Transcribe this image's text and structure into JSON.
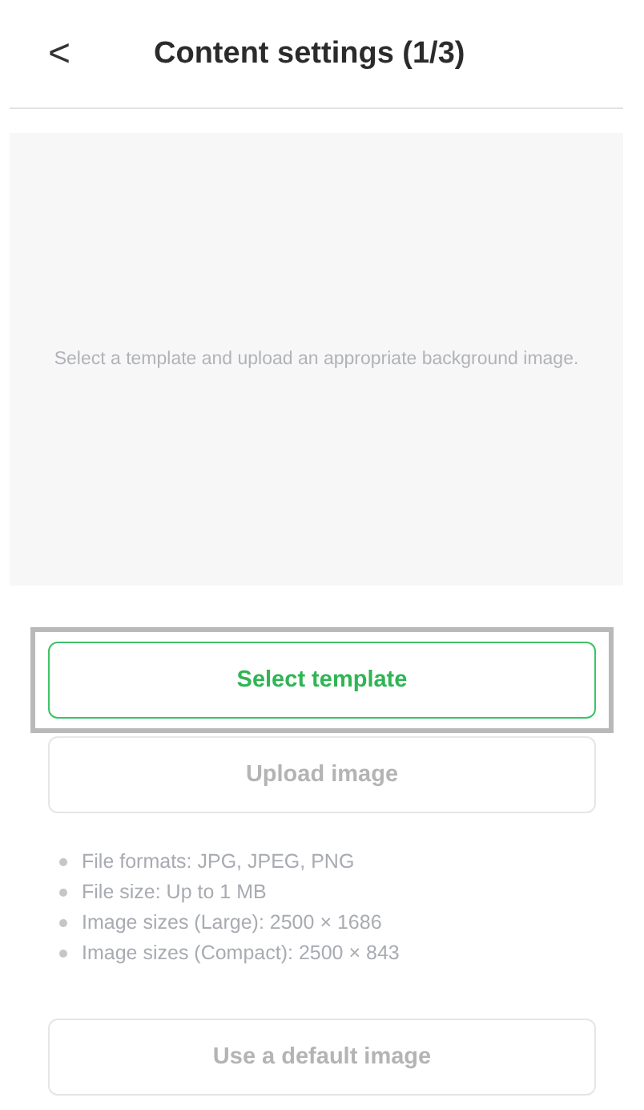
{
  "header": {
    "back": "<",
    "title": "Content settings (1/3)"
  },
  "preview": {
    "hint": "Select a template and upload an appropriate background image."
  },
  "buttons": [
    {
      "label": "Select template",
      "disabled": false,
      "focused": true
    },
    {
      "label": "Upload image",
      "disabled": true,
      "focused": false
    }
  ],
  "requirements": [
    "File formats: JPG, JPEG, PNG",
    "File size: Up to 1 MB",
    "Image sizes (Large): 2500 × 1686",
    "Image sizes (Compact): 2500 × 843"
  ],
  "footer_button": {
    "label": "Use a default image",
    "disabled": true
  }
}
